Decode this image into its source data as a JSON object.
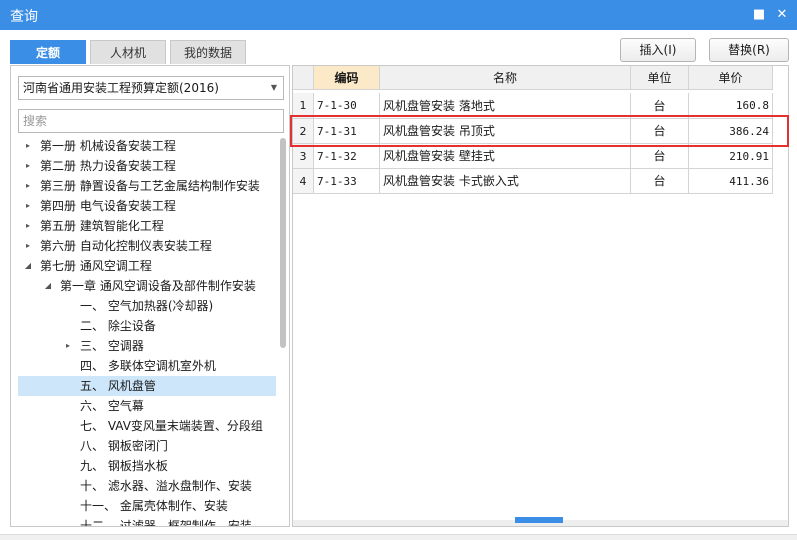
{
  "window": {
    "title": "查询",
    "min_glyph": "■",
    "close_glyph": "✕",
    "accent": "#3a8ee6"
  },
  "tabs": [
    {
      "label": "定额",
      "active": true
    },
    {
      "label": "人材机",
      "active": false
    },
    {
      "label": "我的数据",
      "active": false
    }
  ],
  "buttons": {
    "insert": "插入(I)",
    "replace": "替换(R)"
  },
  "left": {
    "quota_select": "河南省通用安装工程预算定额(2016)",
    "search_placeholder": "搜索",
    "tree": [
      {
        "label": "第一册 机械设备安装工程",
        "level": 0,
        "toggle": "▸",
        "selected": false
      },
      {
        "label": "第二册 热力设备安装工程",
        "level": 0,
        "toggle": "▸",
        "selected": false
      },
      {
        "label": "第三册 静置设备与工艺金属结构制作安装",
        "level": 0,
        "toggle": "▸",
        "selected": false
      },
      {
        "label": "第四册 电气设备安装工程",
        "level": 0,
        "toggle": "▸",
        "selected": false
      },
      {
        "label": "第五册 建筑智能化工程",
        "level": 0,
        "toggle": "▸",
        "selected": false
      },
      {
        "label": "第六册 自动化控制仪表安装工程",
        "level": 0,
        "toggle": "▸",
        "selected": false
      },
      {
        "label": "第七册 通风空调工程",
        "level": 0,
        "toggle": "◢",
        "selected": false
      },
      {
        "label": "第一章 通风空调设备及部件制作安装",
        "level": 1,
        "toggle": "◢",
        "selected": false
      },
      {
        "label": "一、 空气加热器(冷却器)",
        "level": 2,
        "toggle": "",
        "selected": false
      },
      {
        "label": "二、 除尘设备",
        "level": 2,
        "toggle": "",
        "selected": false
      },
      {
        "label": "三、 空调器",
        "level": 2,
        "toggle": "▸",
        "selected": false
      },
      {
        "label": "四、 多联体空调机室外机",
        "level": 2,
        "toggle": "",
        "selected": false
      },
      {
        "label": "五、 风机盘管",
        "level": 2,
        "toggle": "",
        "selected": true
      },
      {
        "label": "六、 空气幕",
        "level": 2,
        "toggle": "",
        "selected": false
      },
      {
        "label": "七、 VAV变风量末端装置、分段组",
        "level": 2,
        "toggle": "",
        "selected": false
      },
      {
        "label": "八、 钢板密闭门",
        "level": 2,
        "toggle": "",
        "selected": false
      },
      {
        "label": "九、 钢板挡水板",
        "level": 2,
        "toggle": "",
        "selected": false
      },
      {
        "label": "十、 滤水器、溢水盘制作、安装",
        "level": 2,
        "toggle": "",
        "selected": false
      },
      {
        "label": "十一、 金属壳体制作、安装",
        "level": 2,
        "toggle": "",
        "selected": false
      },
      {
        "label": "十二、 过滤器、框架制作、安装",
        "level": 2,
        "toggle": "",
        "selected": false
      }
    ]
  },
  "table": {
    "headers": {
      "rownum": "",
      "code": "编码",
      "name": "名称",
      "unit": "单位",
      "price": "单价"
    },
    "rows": [
      {
        "no": "1",
        "code": "7-1-30",
        "name": "风机盘管安装 落地式",
        "unit": "台",
        "price": "160.8"
      },
      {
        "no": "2",
        "code": "7-1-31",
        "name": "风机盘管安装 吊顶式",
        "unit": "台",
        "price": "386.24"
      },
      {
        "no": "3",
        "code": "7-1-32",
        "name": "风机盘管安装 壁挂式",
        "unit": "台",
        "price": "210.91"
      },
      {
        "no": "4",
        "code": "7-1-33",
        "name": "风机盘管安装 卡式嵌入式",
        "unit": "台",
        "price": "411.36"
      }
    ],
    "highlight_color": "#e63030",
    "scroll_glyph": "⌃"
  }
}
